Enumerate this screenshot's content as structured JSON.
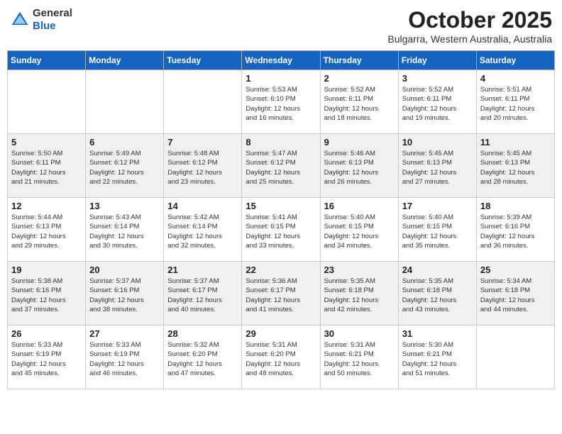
{
  "header": {
    "logo_general": "General",
    "logo_blue": "Blue",
    "month": "October 2025",
    "location": "Bulgarra, Western Australia, Australia"
  },
  "days_of_week": [
    "Sunday",
    "Monday",
    "Tuesday",
    "Wednesday",
    "Thursday",
    "Friday",
    "Saturday"
  ],
  "weeks": [
    {
      "shaded": false,
      "days": [
        {
          "num": "",
          "info": ""
        },
        {
          "num": "",
          "info": ""
        },
        {
          "num": "",
          "info": ""
        },
        {
          "num": "1",
          "info": "Sunrise: 5:53 AM\nSunset: 6:10 PM\nDaylight: 12 hours\nand 16 minutes."
        },
        {
          "num": "2",
          "info": "Sunrise: 5:52 AM\nSunset: 6:11 PM\nDaylight: 12 hours\nand 18 minutes."
        },
        {
          "num": "3",
          "info": "Sunrise: 5:52 AM\nSunset: 6:11 PM\nDaylight: 12 hours\nand 19 minutes."
        },
        {
          "num": "4",
          "info": "Sunrise: 5:51 AM\nSunset: 6:11 PM\nDaylight: 12 hours\nand 20 minutes."
        }
      ]
    },
    {
      "shaded": true,
      "days": [
        {
          "num": "5",
          "info": "Sunrise: 5:50 AM\nSunset: 6:11 PM\nDaylight: 12 hours\nand 21 minutes."
        },
        {
          "num": "6",
          "info": "Sunrise: 5:49 AM\nSunset: 6:12 PM\nDaylight: 12 hours\nand 22 minutes."
        },
        {
          "num": "7",
          "info": "Sunrise: 5:48 AM\nSunset: 6:12 PM\nDaylight: 12 hours\nand 23 minutes."
        },
        {
          "num": "8",
          "info": "Sunrise: 5:47 AM\nSunset: 6:12 PM\nDaylight: 12 hours\nand 25 minutes."
        },
        {
          "num": "9",
          "info": "Sunrise: 5:46 AM\nSunset: 6:13 PM\nDaylight: 12 hours\nand 26 minutes."
        },
        {
          "num": "10",
          "info": "Sunrise: 5:45 AM\nSunset: 6:13 PM\nDaylight: 12 hours\nand 27 minutes."
        },
        {
          "num": "11",
          "info": "Sunrise: 5:45 AM\nSunset: 6:13 PM\nDaylight: 12 hours\nand 28 minutes."
        }
      ]
    },
    {
      "shaded": false,
      "days": [
        {
          "num": "12",
          "info": "Sunrise: 5:44 AM\nSunset: 6:13 PM\nDaylight: 12 hours\nand 29 minutes."
        },
        {
          "num": "13",
          "info": "Sunrise: 5:43 AM\nSunset: 6:14 PM\nDaylight: 12 hours\nand 30 minutes."
        },
        {
          "num": "14",
          "info": "Sunrise: 5:42 AM\nSunset: 6:14 PM\nDaylight: 12 hours\nand 32 minutes."
        },
        {
          "num": "15",
          "info": "Sunrise: 5:41 AM\nSunset: 6:15 PM\nDaylight: 12 hours\nand 33 minutes."
        },
        {
          "num": "16",
          "info": "Sunrise: 5:40 AM\nSunset: 6:15 PM\nDaylight: 12 hours\nand 34 minutes."
        },
        {
          "num": "17",
          "info": "Sunrise: 5:40 AM\nSunset: 6:15 PM\nDaylight: 12 hours\nand 35 minutes."
        },
        {
          "num": "18",
          "info": "Sunrise: 5:39 AM\nSunset: 6:16 PM\nDaylight: 12 hours\nand 36 minutes."
        }
      ]
    },
    {
      "shaded": true,
      "days": [
        {
          "num": "19",
          "info": "Sunrise: 5:38 AM\nSunset: 6:16 PM\nDaylight: 12 hours\nand 37 minutes."
        },
        {
          "num": "20",
          "info": "Sunrise: 5:37 AM\nSunset: 6:16 PM\nDaylight: 12 hours\nand 38 minutes."
        },
        {
          "num": "21",
          "info": "Sunrise: 5:37 AM\nSunset: 6:17 PM\nDaylight: 12 hours\nand 40 minutes."
        },
        {
          "num": "22",
          "info": "Sunrise: 5:36 AM\nSunset: 6:17 PM\nDaylight: 12 hours\nand 41 minutes."
        },
        {
          "num": "23",
          "info": "Sunrise: 5:35 AM\nSunset: 6:18 PM\nDaylight: 12 hours\nand 42 minutes."
        },
        {
          "num": "24",
          "info": "Sunrise: 5:35 AM\nSunset: 6:18 PM\nDaylight: 12 hours\nand 43 minutes."
        },
        {
          "num": "25",
          "info": "Sunrise: 5:34 AM\nSunset: 6:18 PM\nDaylight: 12 hours\nand 44 minutes."
        }
      ]
    },
    {
      "shaded": false,
      "days": [
        {
          "num": "26",
          "info": "Sunrise: 5:33 AM\nSunset: 6:19 PM\nDaylight: 12 hours\nand 45 minutes."
        },
        {
          "num": "27",
          "info": "Sunrise: 5:33 AM\nSunset: 6:19 PM\nDaylight: 12 hours\nand 46 minutes."
        },
        {
          "num": "28",
          "info": "Sunrise: 5:32 AM\nSunset: 6:20 PM\nDaylight: 12 hours\nand 47 minutes."
        },
        {
          "num": "29",
          "info": "Sunrise: 5:31 AM\nSunset: 6:20 PM\nDaylight: 12 hours\nand 48 minutes."
        },
        {
          "num": "30",
          "info": "Sunrise: 5:31 AM\nSunset: 6:21 PM\nDaylight: 12 hours\nand 50 minutes."
        },
        {
          "num": "31",
          "info": "Sunrise: 5:30 AM\nSunset: 6:21 PM\nDaylight: 12 hours\nand 51 minutes."
        },
        {
          "num": "",
          "info": ""
        }
      ]
    }
  ]
}
